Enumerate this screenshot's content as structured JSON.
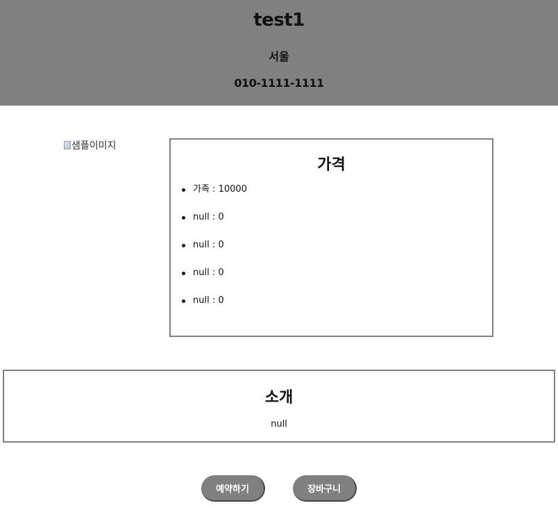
{
  "header": {
    "title": "test1",
    "region": "서울",
    "phone": "010-1111-1111"
  },
  "image": {
    "alt": "샘플이미지"
  },
  "price": {
    "title": "가격",
    "items": [
      "가족 : 10000",
      "null : 0",
      "null : 0",
      "null : 0",
      "null : 0"
    ]
  },
  "intro": {
    "title": "소개",
    "text": "null"
  },
  "actions": {
    "reserve_label": "예약하기",
    "cart_label": "장바구니"
  },
  "colors": {
    "header_bg": "#808080",
    "button_bg": "#808080",
    "border": "#808080"
  }
}
